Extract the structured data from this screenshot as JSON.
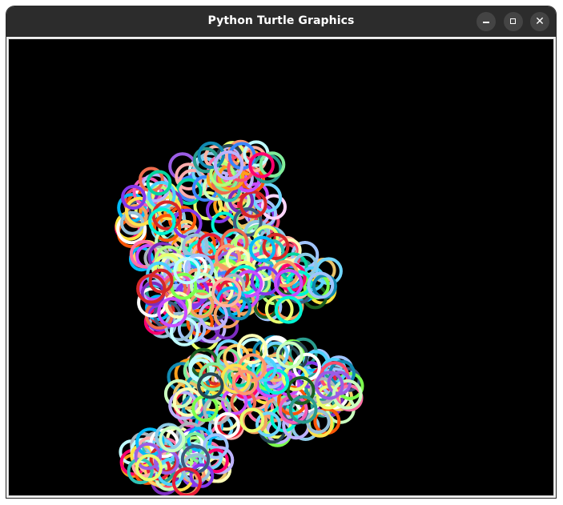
{
  "window": {
    "title": "Python Turtle Graphics"
  },
  "controls": {
    "minimize_icon": "minimize-icon",
    "maximize_icon": "maximize-icon",
    "close_icon": "close-icon"
  },
  "canvas": {
    "background": "#000000",
    "content": "many overlapping colored ring outlines"
  },
  "palette": [
    "#ff4d6d",
    "#4dd2ff",
    "#ffe14d",
    "#7cff4d",
    "#c84dff",
    "#ff9f1c",
    "#2ec4b6",
    "#e71d36",
    "#8ecae6",
    "#ffb4a2",
    "#b5ff7d",
    "#9b5de5",
    "#f15bb5",
    "#00bbf9",
    "#00f5d4",
    "#fee440",
    "#ff006e",
    "#8338ec",
    "#3a86ff",
    "#fb5607",
    "#80ed99",
    "#c0fdff",
    "#ffd6ff",
    "#a0c4ff",
    "#bdb2ff",
    "#caffbf",
    "#fdffb6",
    "#ffadad",
    "#06d6a0",
    "#118ab2",
    "#ef476f",
    "#ffd166",
    "#3d5a80",
    "#98c1d9",
    "#ee6c4d",
    "#f4a261",
    "#2a9d8f",
    "#e9c46a",
    "#264653",
    "#d62828",
    "#adb5bd",
    "#ffffff",
    "#1b5e20",
    "#7b2cbf",
    "#ff70a6",
    "#70d6ff",
    "#ff9770",
    "#e9ff70"
  ]
}
